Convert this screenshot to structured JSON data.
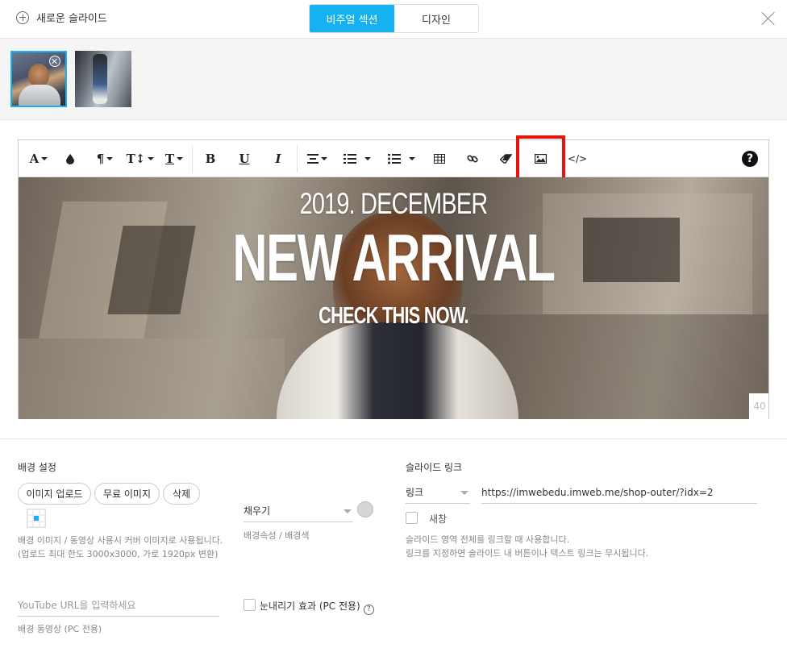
{
  "header": {
    "new_slide_label": "새로운 슬라이드",
    "tabs": [
      {
        "label": "비주얼 섹션",
        "active": true
      },
      {
        "label": "디자인",
        "active": false
      }
    ]
  },
  "toolbar": {
    "buttons": [
      "font-color",
      "text-highlight",
      "paragraph",
      "font-size",
      "font-style",
      "bold",
      "underline",
      "italic",
      "align",
      "ordered-list",
      "unordered-list",
      "table",
      "link",
      "eraser",
      "image",
      "code-view",
      "help"
    ],
    "highlighted_button": "image",
    "help_label": "?"
  },
  "banner": {
    "line1": "2019. DECEMBER",
    "line2": "NEW ARRIVAL",
    "line3": "CHECK THIS NOW.",
    "counter": "40"
  },
  "background": {
    "title": "배경 설정",
    "buttons": [
      "이미지 업로드",
      "무료 이미지",
      "삭제"
    ],
    "help_line1": "배경 이미지 / 동영상 사용시 커버 이미지로 사용됩니다.",
    "help_line2": "(업로드 최대 한도 3000x3000, 가로 1920px 변환)",
    "fill_select": "채우기",
    "fill_caption": "배경속성 / 배경색",
    "youtube_placeholder": "YouTube URL을 입력하세요",
    "youtube_caption": "배경 동영상 (PC 전용)",
    "snow_label": "눈내리기 효과 (PC 전용)"
  },
  "slide_link": {
    "title": "슬라이드 링크",
    "type_select": "링크",
    "url": "https://imwebedu.imweb.me/shop-outer/?idx=2",
    "new_window_label": "새창",
    "help_line1": "슬라이드 영역 전체를 링크할 때 사용합니다.",
    "help_line2": "링크를 지정하면 슬라이드 내 버튼이나 텍스트 링크는 무시됩니다."
  },
  "colors": {
    "accent": "#16b1f0",
    "highlight": "#e8140c"
  }
}
